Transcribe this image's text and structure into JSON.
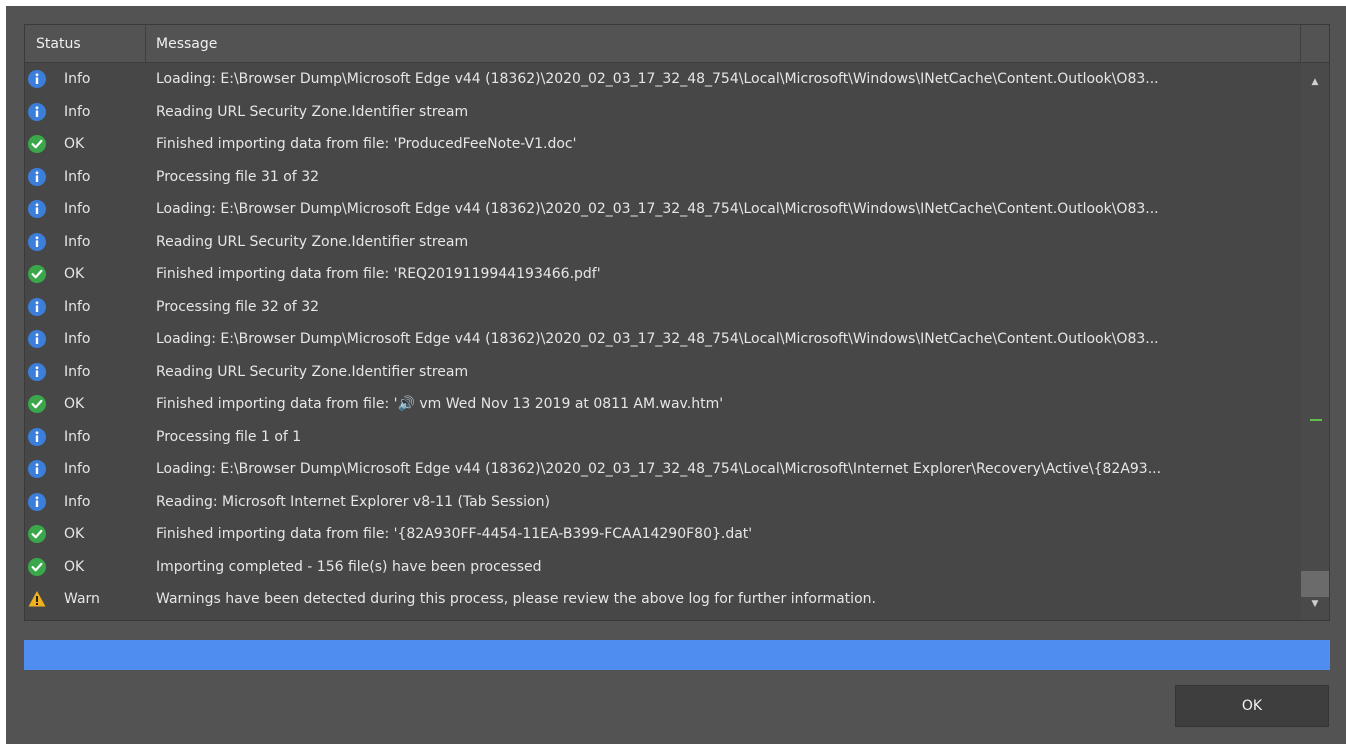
{
  "colors": {
    "dialog_bg": "#535353",
    "grid_bg": "#474747",
    "info": "#3b7fdb",
    "ok": "#3aa84a",
    "warn": "#f2b01e",
    "progress": "#4f8ef0",
    "scroll_marker": "#5fbf4d"
  },
  "log": {
    "columns": {
      "status": "Status",
      "message": "Message"
    },
    "rows": [
      {
        "icon": "info-icon",
        "status": "Info",
        "message": "Loading: E:\\Browser Dump\\Microsoft Edge v44 (18362)\\2020_02_03_17_32_48_754\\Local\\Microsoft\\Windows\\INetCache\\Content.Outlook\\O83..."
      },
      {
        "icon": "info-icon",
        "status": "Info",
        "message": "Reading URL Security Zone.Identifier stream"
      },
      {
        "icon": "ok-icon",
        "status": "OK",
        "message": "Finished importing data from file: 'ProducedFeeNote-V1.doc'"
      },
      {
        "icon": "info-icon",
        "status": "Info",
        "message": "Processing file 31 of 32"
      },
      {
        "icon": "info-icon",
        "status": "Info",
        "message": "Loading: E:\\Browser Dump\\Microsoft Edge v44 (18362)\\2020_02_03_17_32_48_754\\Local\\Microsoft\\Windows\\INetCache\\Content.Outlook\\O83..."
      },
      {
        "icon": "info-icon",
        "status": "Info",
        "message": "Reading URL Security Zone.Identifier stream"
      },
      {
        "icon": "ok-icon",
        "status": "OK",
        "message": "Finished importing data from file: 'REQ2019119944193466.pdf'"
      },
      {
        "icon": "info-icon",
        "status": "Info",
        "message": "Processing file 32 of 32"
      },
      {
        "icon": "info-icon",
        "status": "Info",
        "message": "Loading: E:\\Browser Dump\\Microsoft Edge v44 (18362)\\2020_02_03_17_32_48_754\\Local\\Microsoft\\Windows\\INetCache\\Content.Outlook\\O83..."
      },
      {
        "icon": "info-icon",
        "status": "Info",
        "message": "Reading URL Security Zone.Identifier stream"
      },
      {
        "icon": "ok-icon",
        "status": "OK",
        "message": "Finished importing data from file: '🔊 vm Wed Nov 13 2019 at 0811 AM.wav.htm'"
      },
      {
        "icon": "info-icon",
        "status": "Info",
        "message": "Processing file 1 of 1"
      },
      {
        "icon": "info-icon",
        "status": "Info",
        "message": "Loading: E:\\Browser Dump\\Microsoft Edge v44 (18362)\\2020_02_03_17_32_48_754\\Local\\Microsoft\\Internet Explorer\\Recovery\\Active\\{82A93..."
      },
      {
        "icon": "info-icon",
        "status": "Info",
        "message": "Reading: Microsoft Internet Explorer v8-11 (Tab Session)"
      },
      {
        "icon": "ok-icon",
        "status": "OK",
        "message": "Finished importing data from file: '{82A930FF-4454-11EA-B399-FCAA14290F80}.dat'"
      },
      {
        "icon": "ok-icon",
        "status": "OK",
        "message": "Importing completed - 156 file(s) have been processed"
      },
      {
        "icon": "warning-icon",
        "status": "Warn",
        "message": "Warnings have been detected during this process, please review the above log for further information."
      }
    ]
  },
  "scrollbar": {
    "up_glyph": "▲",
    "down_glyph": "▼"
  },
  "progress": {
    "fraction": 1.0
  },
  "buttons": {
    "ok_label": "OK"
  }
}
